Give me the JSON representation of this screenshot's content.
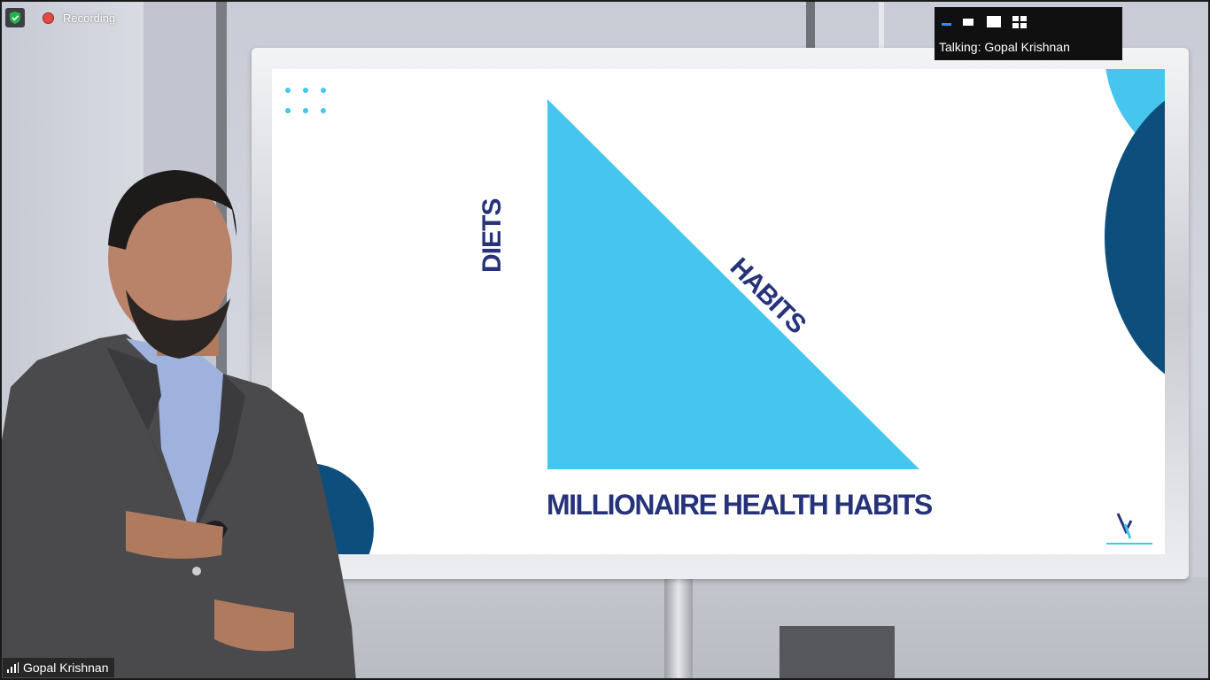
{
  "recording": {
    "label": "Recording"
  },
  "speaker_panel": {
    "talking": "Talking: Gopal Krishnan",
    "views": [
      "minimize-view-icon",
      "thumbnail-view-icon",
      "speaker-view-icon",
      "gallery-view-icon"
    ]
  },
  "participant": {
    "name": "Gopal Krishnan"
  },
  "slide": {
    "left_label": "DIETS",
    "hypotenuse_label": "HABITS",
    "title": "MILLIONAIRE HEALTH HABITS"
  },
  "colors": {
    "slide_accent": "#46c6ee",
    "slide_text": "#26337a",
    "slide_dark": "#0d4e7d",
    "recording_dot": "#e24b3f",
    "security_shield": "#27b34a"
  }
}
